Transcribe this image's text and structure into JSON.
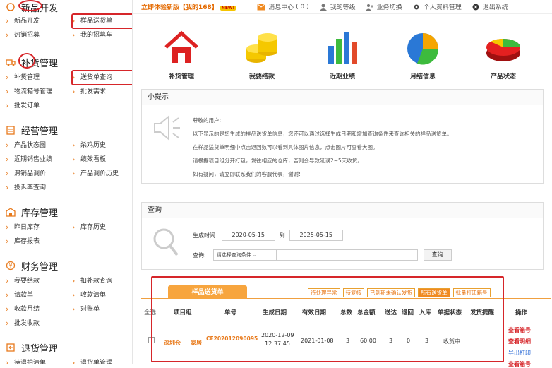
{
  "topbar": {
    "promo": "立即体验新版【我的168】",
    "promo_badge": "NEW!",
    "msg_label": "消息中心",
    "msg_count": "( 0 )",
    "level": "我的等级",
    "switch": "业务切换",
    "profile": "个人资料管理",
    "logout": "退出系统"
  },
  "sidebar": {
    "sections": [
      {
        "title": "新品开发",
        "items": [
          "新品开发",
          "样品送货单",
          "热销招募",
          "我的招募车"
        ]
      },
      {
        "title": "补货管理",
        "items": [
          "补货管理",
          "送货单查询",
          "物流箱号管理",
          "批发需求",
          "批发订单"
        ]
      },
      {
        "title": "经营管理",
        "items": [
          "产品状态图",
          "杀鸡历史",
          "近期销售业绩",
          "绩效看板",
          "滞销品调价",
          "产品调价历史",
          "投诉率查询"
        ]
      },
      {
        "title": "库存管理",
        "items": [
          "昨日库存",
          "库存历史",
          "库存报表"
        ]
      },
      {
        "title": "财务管理",
        "items": [
          "我要结款",
          "扣补款查询",
          "请款单",
          "收款清单",
          "收款月结",
          "对账单",
          "批发收款"
        ]
      },
      {
        "title": "退货管理",
        "items": [
          "待退拍清单",
          "退货单管理"
        ]
      }
    ]
  },
  "shortcuts": [
    "补货管理",
    "我要结款",
    "近期业绩",
    "月结信息",
    "产品状态"
  ],
  "tips": {
    "title": "小提示",
    "lines": [
      "尊敬的用户:",
      "以下显示的是您生成的样品送货单信息，您还可以通过选择生成日期和增加查询条件来查询相关的样品送货单。",
      "在样品送货单明细中点击退回数可以看到具体图片信息，点击图片可查看大图。",
      "请根据项目组分开打包，发往相应的仓库，否则会导致延误2~5天收货。",
      "如有疑问，请立即联系我们的客服代表，谢谢!"
    ]
  },
  "query": {
    "title": "查询",
    "gen_time_label": "生成时间:",
    "date_from": "2020-05-15",
    "to_label": "到",
    "date_to": "2025-05-15",
    "search_label": "查询:",
    "select_placeholder": "请选择查询条件",
    "button": "查询"
  },
  "table": {
    "tab": "样品送货单",
    "filters": [
      "待处理异常",
      "待复核",
      "已到期未确认发货",
      "所有送货单",
      "批量打印箱号"
    ],
    "active_filter": "所有送货单",
    "headers": [
      "全选",
      "项目组",
      "单号",
      "生成日期",
      "有效日期",
      "总数",
      "总金额",
      "送达",
      "退回",
      "入库",
      "单据状态",
      "发货提醒",
      "操作"
    ],
    "row": {
      "group1": "深圳仓",
      "group2": "家居",
      "order_no": "CE202012090095",
      "gen_date": "2020-12-09",
      "gen_time": "12:37:45",
      "valid_date": "2021-01-08",
      "total": "3",
      "amount": "60.00",
      "delivered": "3",
      "returned": "0",
      "stocked": "3",
      "status": "收货中",
      "ops": [
        "查看箱号",
        "查看明细",
        "导出打印"
      ]
    },
    "next_op": "查看箱号"
  }
}
